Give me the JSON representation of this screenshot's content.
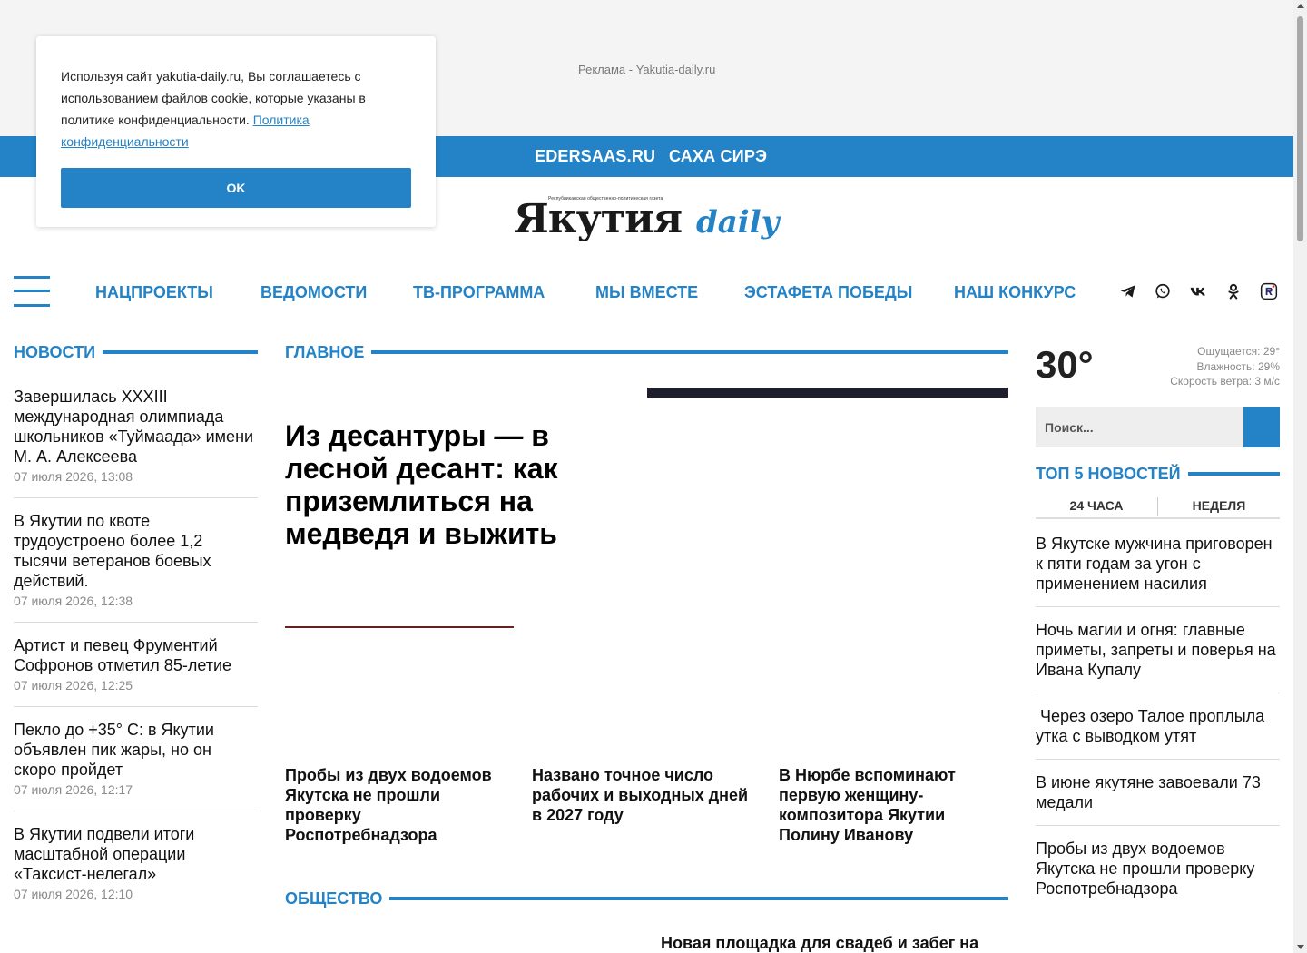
{
  "ad": {
    "label": "Реклама - Yakutia-daily.ru"
  },
  "topbar": {
    "links": [
      "EDERSAAS.RU",
      "САХА СИРЭ"
    ]
  },
  "logo": {
    "tagline": "Республиканская общественно-политическая газета",
    "main": "Якутия",
    "accent": "daily"
  },
  "nav": {
    "items": [
      "НАЦПРОЕКТЫ",
      "ВЕДОМОСТИ",
      "ТВ-ПРОГРАММА",
      "МЫ ВМЕСТЕ",
      "ЭСТАФЕТА ПОБЕДЫ",
      "НАШ КОНКУРС"
    ],
    "social_icons": [
      "telegram-icon",
      "whatsapp-icon",
      "vk-icon",
      "odnoklassniki-icon",
      "rutube-icon"
    ]
  },
  "news": {
    "heading": "НОВОСТИ",
    "items": [
      {
        "title": "Завершилась XXXIII международная олимпиада школьников «Туймаада» имени М. А. Алексеева",
        "date": "07 июля 2026, 13:08"
      },
      {
        "title": "В Якутии по квоте трудоустроено более 1,2 тысячи ветеранов боевых действий.",
        "date": "07 июля 2026, 12:38"
      },
      {
        "title": "Артист и певец Фрументий Софронов отметил 85-летие",
        "date": "07 июля 2026, 12:25"
      },
      {
        "title": "Пекло до +35° С: в Якутии объявлен пик жары, но он скоро пройдет",
        "date": "07 июля 2026, 12:17"
      },
      {
        "title": "В Якутии подвели итоги масштабной операции «Таксист-нелегал»",
        "date": "07 июля 2026, 12:10"
      }
    ]
  },
  "main": {
    "heading": "ГЛАВНОЕ",
    "lead_title": "Из десантуры — в лесной десант: как приземлиться на медведя и выжить",
    "sub_news": [
      "Пробы из двух водоемов Якутска не прошли проверку Роспотребнадзора",
      "Названо точное число рабочих и выходных дней в 2027 году",
      "В Нюрбе вспоминают первую женщину-композитора Якутии Полину Иванову"
    ]
  },
  "society": {
    "heading": "ОБЩЕСТВО",
    "teaser": "Новая площадка для свадеб и забег на"
  },
  "weather": {
    "temp": "30°",
    "feels": "Ощущается: 29°",
    "humidity": "Влажность: 29%",
    "wind": "Скорость ветра: 3 м/с"
  },
  "search": {
    "placeholder": "Поиск..."
  },
  "top5": {
    "heading": "ТОП 5 НОВОСТЕЙ",
    "tabs": [
      "24 ЧАСА",
      "НЕДЕЛЯ"
    ],
    "items": [
      "В Якутске мужчина приговорен к пяти годам за угон с применением насилия",
      "Ночь магии и огня: главные приметы, запреты и поверья на Ивана Купалу",
      " Через озеро Талое проплыла утка с выводком утят",
      "В июне якутяне завоевали 73 медали",
      "Пробы из двух водоемов Якутска не прошли проверку Роспотребнадзора"
    ]
  },
  "cookie": {
    "text": "Используя сайт yakutia-daily.ru, Вы соглашаетесь с использованием файлов cookie, которые указаны в политике конфиденциальности.",
    "link": "Политика конфиденциальности",
    "button": "OK"
  },
  "colors": {
    "accent": "#2383c6",
    "text": "#111111",
    "muted": "#8a8a8a"
  }
}
